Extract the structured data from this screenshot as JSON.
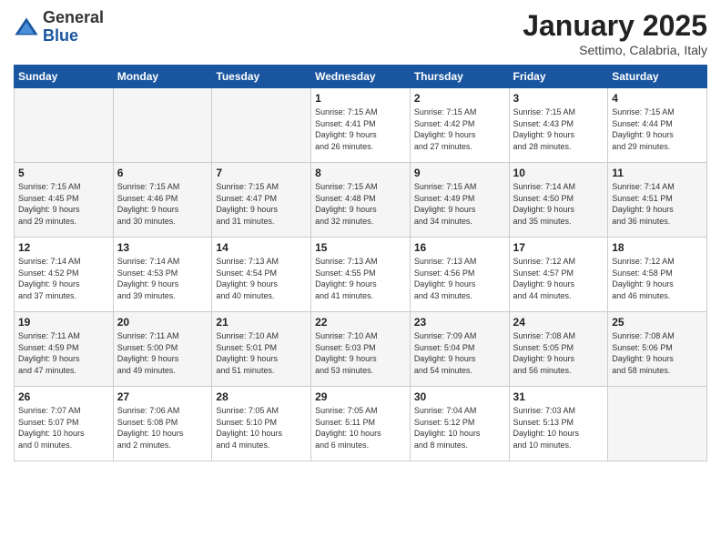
{
  "logo": {
    "general": "General",
    "blue": "Blue"
  },
  "header": {
    "month": "January 2025",
    "location": "Settimo, Calabria, Italy"
  },
  "weekdays": [
    "Sunday",
    "Monday",
    "Tuesday",
    "Wednesday",
    "Thursday",
    "Friday",
    "Saturday"
  ],
  "weeks": [
    [
      {
        "day": "",
        "info": ""
      },
      {
        "day": "",
        "info": ""
      },
      {
        "day": "",
        "info": ""
      },
      {
        "day": "1",
        "info": "Sunrise: 7:15 AM\nSunset: 4:41 PM\nDaylight: 9 hours\nand 26 minutes."
      },
      {
        "day": "2",
        "info": "Sunrise: 7:15 AM\nSunset: 4:42 PM\nDaylight: 9 hours\nand 27 minutes."
      },
      {
        "day": "3",
        "info": "Sunrise: 7:15 AM\nSunset: 4:43 PM\nDaylight: 9 hours\nand 28 minutes."
      },
      {
        "day": "4",
        "info": "Sunrise: 7:15 AM\nSunset: 4:44 PM\nDaylight: 9 hours\nand 29 minutes."
      }
    ],
    [
      {
        "day": "5",
        "info": "Sunrise: 7:15 AM\nSunset: 4:45 PM\nDaylight: 9 hours\nand 29 minutes."
      },
      {
        "day": "6",
        "info": "Sunrise: 7:15 AM\nSunset: 4:46 PM\nDaylight: 9 hours\nand 30 minutes."
      },
      {
        "day": "7",
        "info": "Sunrise: 7:15 AM\nSunset: 4:47 PM\nDaylight: 9 hours\nand 31 minutes."
      },
      {
        "day": "8",
        "info": "Sunrise: 7:15 AM\nSunset: 4:48 PM\nDaylight: 9 hours\nand 32 minutes."
      },
      {
        "day": "9",
        "info": "Sunrise: 7:15 AM\nSunset: 4:49 PM\nDaylight: 9 hours\nand 34 minutes."
      },
      {
        "day": "10",
        "info": "Sunrise: 7:14 AM\nSunset: 4:50 PM\nDaylight: 9 hours\nand 35 minutes."
      },
      {
        "day": "11",
        "info": "Sunrise: 7:14 AM\nSunset: 4:51 PM\nDaylight: 9 hours\nand 36 minutes."
      }
    ],
    [
      {
        "day": "12",
        "info": "Sunrise: 7:14 AM\nSunset: 4:52 PM\nDaylight: 9 hours\nand 37 minutes."
      },
      {
        "day": "13",
        "info": "Sunrise: 7:14 AM\nSunset: 4:53 PM\nDaylight: 9 hours\nand 39 minutes."
      },
      {
        "day": "14",
        "info": "Sunrise: 7:13 AM\nSunset: 4:54 PM\nDaylight: 9 hours\nand 40 minutes."
      },
      {
        "day": "15",
        "info": "Sunrise: 7:13 AM\nSunset: 4:55 PM\nDaylight: 9 hours\nand 41 minutes."
      },
      {
        "day": "16",
        "info": "Sunrise: 7:13 AM\nSunset: 4:56 PM\nDaylight: 9 hours\nand 43 minutes."
      },
      {
        "day": "17",
        "info": "Sunrise: 7:12 AM\nSunset: 4:57 PM\nDaylight: 9 hours\nand 44 minutes."
      },
      {
        "day": "18",
        "info": "Sunrise: 7:12 AM\nSunset: 4:58 PM\nDaylight: 9 hours\nand 46 minutes."
      }
    ],
    [
      {
        "day": "19",
        "info": "Sunrise: 7:11 AM\nSunset: 4:59 PM\nDaylight: 9 hours\nand 47 minutes."
      },
      {
        "day": "20",
        "info": "Sunrise: 7:11 AM\nSunset: 5:00 PM\nDaylight: 9 hours\nand 49 minutes."
      },
      {
        "day": "21",
        "info": "Sunrise: 7:10 AM\nSunset: 5:01 PM\nDaylight: 9 hours\nand 51 minutes."
      },
      {
        "day": "22",
        "info": "Sunrise: 7:10 AM\nSunset: 5:03 PM\nDaylight: 9 hours\nand 53 minutes."
      },
      {
        "day": "23",
        "info": "Sunrise: 7:09 AM\nSunset: 5:04 PM\nDaylight: 9 hours\nand 54 minutes."
      },
      {
        "day": "24",
        "info": "Sunrise: 7:08 AM\nSunset: 5:05 PM\nDaylight: 9 hours\nand 56 minutes."
      },
      {
        "day": "25",
        "info": "Sunrise: 7:08 AM\nSunset: 5:06 PM\nDaylight: 9 hours\nand 58 minutes."
      }
    ],
    [
      {
        "day": "26",
        "info": "Sunrise: 7:07 AM\nSunset: 5:07 PM\nDaylight: 10 hours\nand 0 minutes."
      },
      {
        "day": "27",
        "info": "Sunrise: 7:06 AM\nSunset: 5:08 PM\nDaylight: 10 hours\nand 2 minutes."
      },
      {
        "day": "28",
        "info": "Sunrise: 7:05 AM\nSunset: 5:10 PM\nDaylight: 10 hours\nand 4 minutes."
      },
      {
        "day": "29",
        "info": "Sunrise: 7:05 AM\nSunset: 5:11 PM\nDaylight: 10 hours\nand 6 minutes."
      },
      {
        "day": "30",
        "info": "Sunrise: 7:04 AM\nSunset: 5:12 PM\nDaylight: 10 hours\nand 8 minutes."
      },
      {
        "day": "31",
        "info": "Sunrise: 7:03 AM\nSunset: 5:13 PM\nDaylight: 10 hours\nand 10 minutes."
      },
      {
        "day": "",
        "info": ""
      }
    ]
  ]
}
